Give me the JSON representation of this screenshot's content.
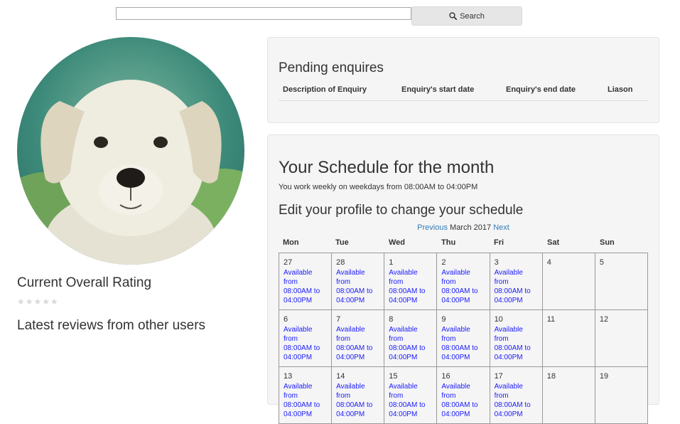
{
  "search": {
    "value": "",
    "button_label": "Search"
  },
  "profile": {
    "rating_title": "Current Overall Rating",
    "stars": "★★★★★",
    "reviews_title": "Latest reviews from other users"
  },
  "pending": {
    "title": "Pending enquires",
    "columns": [
      "Description of Enquiry",
      "Enquiry's start date",
      "Enquiry's end date",
      "Liason"
    ]
  },
  "schedule": {
    "title": "Your Schedule for the month",
    "work_text": "You work weekly on weekdays from 08:00AM to 04:00PM",
    "edit_title": "Edit your profile to change your schedule",
    "nav": {
      "previous": "Previous",
      "month": "March 2017",
      "next": "Next"
    },
    "weekdays": [
      "Mon",
      "Tue",
      "Wed",
      "Thu",
      "Fri",
      "Sat",
      "Sun"
    ],
    "availability_text": "Available from 08:00AM to 04:00PM",
    "weeks": [
      [
        {
          "day": "27",
          "avail": true
        },
        {
          "day": "28",
          "avail": true
        },
        {
          "day": "1",
          "avail": true
        },
        {
          "day": "2",
          "avail": true
        },
        {
          "day": "3",
          "avail": true
        },
        {
          "day": "4",
          "avail": false
        },
        {
          "day": "5",
          "avail": false
        }
      ],
      [
        {
          "day": "6",
          "avail": true
        },
        {
          "day": "7",
          "avail": true
        },
        {
          "day": "8",
          "avail": true
        },
        {
          "day": "9",
          "avail": true
        },
        {
          "day": "10",
          "avail": true
        },
        {
          "day": "11",
          "avail": false
        },
        {
          "day": "12",
          "avail": false
        }
      ],
      [
        {
          "day": "13",
          "avail": true
        },
        {
          "day": "14",
          "avail": true
        },
        {
          "day": "15",
          "avail": true
        },
        {
          "day": "16",
          "avail": true
        },
        {
          "day": "17",
          "avail": true
        },
        {
          "day": "18",
          "avail": false
        },
        {
          "day": "19",
          "avail": false
        }
      ]
    ]
  },
  "colors": {
    "link": "#337ab7",
    "availability": "#1a1aff",
    "panel_bg": "#f5f5f5"
  }
}
